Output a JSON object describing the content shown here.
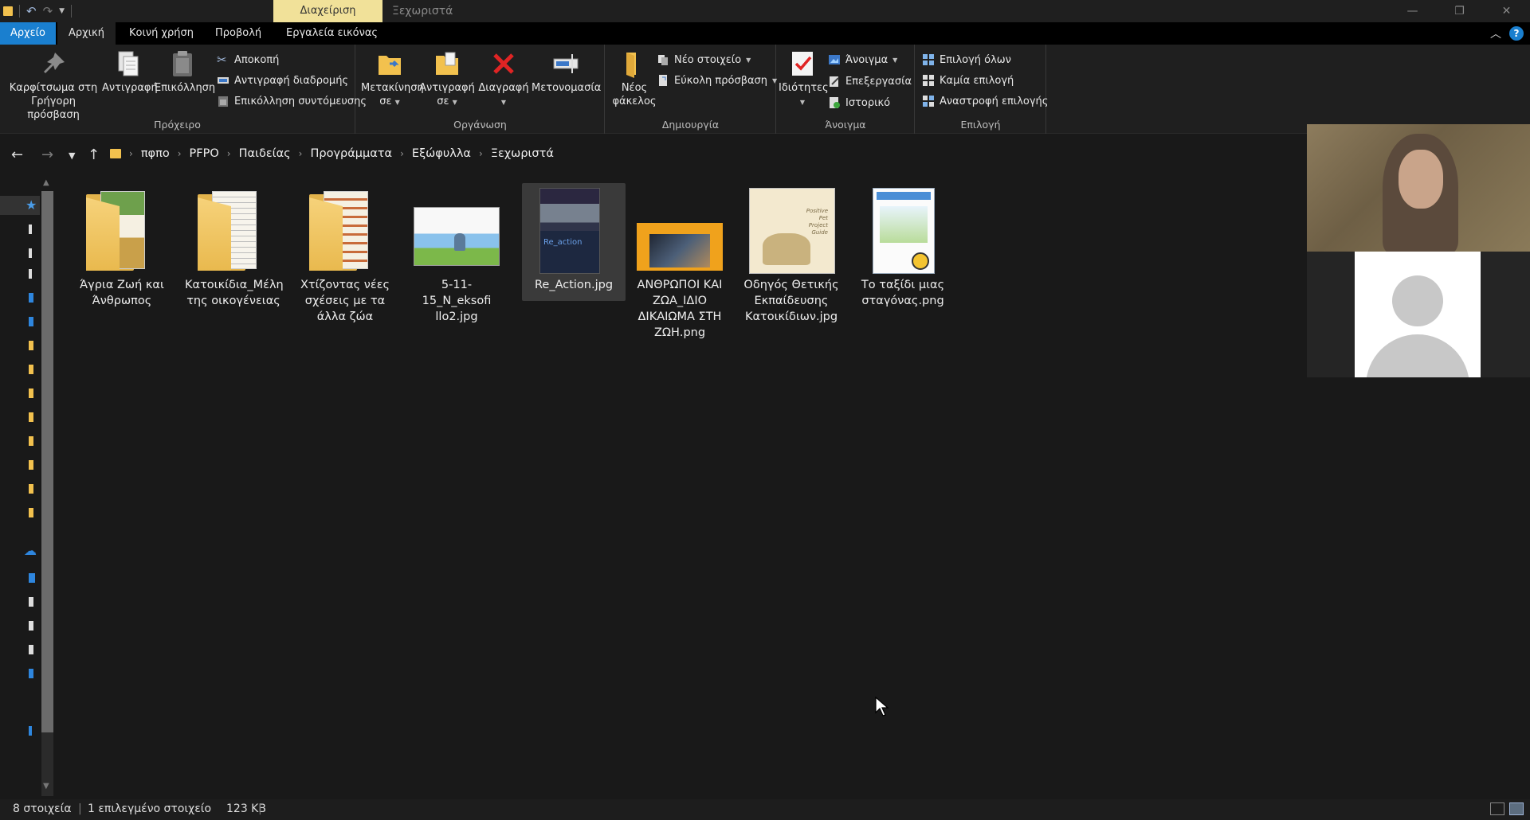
{
  "titlebar": {
    "context_tab": "Διαχείριση",
    "window_title": "Ξεχωριστά",
    "controls": {
      "minimize": "—",
      "maximize": "❐",
      "close": "✕"
    }
  },
  "tabs": {
    "file": "Αρχείο",
    "home": "Αρχική",
    "share": "Κοινή χρήση",
    "view": "Προβολή",
    "picture_tools": "Εργαλεία εικόνας",
    "help": "?"
  },
  "ribbon": {
    "clipboard": {
      "label": "Πρόχειρο",
      "pin_line1": "Καρφίτσωμα στη",
      "pin_line2": "Γρήγορη πρόσβαση",
      "copy": "Αντιγραφή",
      "paste": "Επικόλληση",
      "cut": "Αποκοπή",
      "copy_path": "Αντιγραφή διαδρομής",
      "paste_shortcut": "Επικόλληση συντόμευσης"
    },
    "organize": {
      "label": "Οργάνωση",
      "move_to_line1": "Μετακίνηση",
      "move_to_line2": "σε",
      "copy_to_line1": "Αντιγραφή",
      "copy_to_line2": "σε",
      "delete": "Διαγραφή",
      "rename": "Μετονομασία"
    },
    "new": {
      "label": "Δημιουργία",
      "new_folder_line1": "Νέος",
      "new_folder_line2": "φάκελος",
      "new_item": "Νέο στοιχείο",
      "easy_access": "Εύκολη πρόσβαση"
    },
    "open": {
      "label": "Άνοιγμα",
      "properties": "Ιδιότητες",
      "open": "Άνοιγμα",
      "edit": "Επεξεργασία",
      "history": "Ιστορικό"
    },
    "select": {
      "label": "Επιλογή",
      "select_all": "Επιλογή όλων",
      "select_none": "Καμία επιλογή",
      "invert": "Αναστροφή επιλογής"
    }
  },
  "breadcrumb": [
    "πφπο",
    "PFPO",
    "Παιδείας",
    "Προγράμματα",
    "Εξώφυλλα",
    "Ξεχωριστά"
  ],
  "files": [
    {
      "line1": "Άγρια Ζωή και",
      "line2": "Άνθρωπος",
      "line3": "",
      "line4": "",
      "type": "folder"
    },
    {
      "line1": "Κατοικίδια_Μέλη",
      "line2": "της οικογένειας",
      "line3": "",
      "line4": "",
      "type": "folder"
    },
    {
      "line1": "Χτίζοντας νέες",
      "line2": "σχέσεις με τα",
      "line3": "άλλα ζώα",
      "line4": "",
      "type": "folder"
    },
    {
      "line1": "5-11-15_N_eksofi",
      "line2": "llo2.jpg",
      "line3": "",
      "line4": "",
      "type": "image"
    },
    {
      "line1": "Re_Action.jpg",
      "line2": "",
      "line3": "",
      "line4": "",
      "type": "image"
    },
    {
      "line1": "ΑΝΘΡΩΠΟΙ ΚΑΙ",
      "line2": "ΖΩΑ_ΙΔΙΟ",
      "line3": "ΔΙΚΑΙΩΜΑ ΣΤΗ",
      "line4": "ΖΩΗ.png",
      "type": "image"
    },
    {
      "line1": "Οδηγός Θετικής",
      "line2": "Εκπαίδευσης",
      "line3": "Κατοικίδιων.jpg",
      "line4": "",
      "type": "image"
    },
    {
      "line1": "Το ταξίδι μιας",
      "line2": "σταγόνας.png",
      "line3": "",
      "line4": "",
      "type": "image"
    }
  ],
  "thumb_text": {
    "positive_pet_line1": "Positive",
    "positive_pet_line2": "Pet",
    "positive_pet_line3": "Project",
    "positive_pet_line4": "Guide",
    "reaction_overlay": "Re_action"
  },
  "status": {
    "count": "8 στοιχεία",
    "selection": "1 επιλεγμένο στοιχείο",
    "size": "123 KB"
  },
  "colors": {
    "accent": "#1a7fcf",
    "context_tab": "#f1e199",
    "background": "#191919",
    "folder": "#f2c14e"
  }
}
